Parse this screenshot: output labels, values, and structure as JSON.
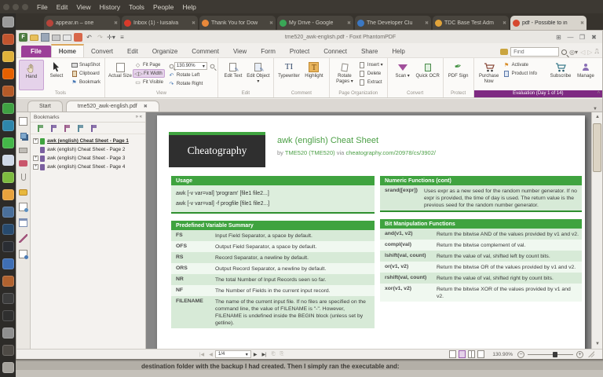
{
  "desktop": {
    "menubar": {
      "items": [
        "File",
        "Edit",
        "View",
        "History",
        "Tools",
        "People",
        "Help"
      ]
    },
    "launcher_items": [
      {
        "name": "settings",
        "color": "#9a9a9a"
      },
      {
        "name": "files",
        "color": "#c0542e"
      },
      {
        "name": "chrome",
        "color": "#e0b23a"
      },
      {
        "name": "firefox",
        "color": "#e66000"
      },
      {
        "name": "terminal",
        "color": "#b35a28"
      },
      {
        "name": "web-green",
        "color": "#3fa142"
      },
      {
        "name": "media-blue",
        "color": "#2e86ab"
      },
      {
        "name": "green-app",
        "color": "#44b749"
      },
      {
        "name": "writer-doc",
        "color": "#cfd8e6"
      },
      {
        "name": "calc-doc",
        "color": "#7dbb3f"
      },
      {
        "name": "impress-doc",
        "color": "#e8a33d"
      },
      {
        "name": "app-mask",
        "color": "#4a6f9a"
      },
      {
        "name": "app-darkblue",
        "color": "#274a6d"
      },
      {
        "name": "steam",
        "color": "#2a2d33"
      },
      {
        "name": "browser-blue",
        "color": "#3f6fb5"
      },
      {
        "name": "app-orange",
        "color": "#b0622f"
      },
      {
        "name": "camera-dark",
        "color": "#3c3c3c"
      },
      {
        "name": "app-dark",
        "color": "#2f2f2f"
      },
      {
        "name": "screenshot-1",
        "color": "#8f8f8f"
      },
      {
        "name": "image-dark",
        "color": "#4e4a45"
      },
      {
        "name": "screenshot-2",
        "color": "#a5a29c"
      }
    ],
    "page_behind_text": "destination folder with the backup I had created. Then I simply ran the executable and:"
  },
  "browser": {
    "tabs": [
      {
        "label": "appear.in – one",
        "color": "#b8443a",
        "active": false
      },
      {
        "label": "Inbox (1) - luisalva",
        "color": "#d93a2b",
        "active": false
      },
      {
        "label": "Thank You for Dow",
        "color": "#e8883a",
        "active": false
      },
      {
        "label": "My Drive - Google",
        "color": "#3aa757",
        "active": false
      },
      {
        "label": "The Developer Clu",
        "color": "#3b78c3",
        "active": false
      },
      {
        "label": "TDC Base Test Adm",
        "color": "#e0a33a",
        "active": false
      },
      {
        "label": "pdf - Possible to in",
        "color": "#d6482f",
        "active": true
      }
    ]
  },
  "app": {
    "title": "tme520_awk-english.pdf - Foxit PhantomPDF",
    "ribbon_tabs": [
      {
        "label": "File",
        "type": "file"
      },
      {
        "label": "Home",
        "type": "active"
      },
      {
        "label": "Convert",
        "type": "normal"
      },
      {
        "label": "Edit",
        "type": "normal"
      },
      {
        "label": "Organize",
        "type": "normal"
      },
      {
        "label": "Comment",
        "type": "normal"
      },
      {
        "label": "View",
        "type": "normal"
      },
      {
        "label": "Form",
        "type": "normal"
      },
      {
        "label": "Protect",
        "type": "normal"
      },
      {
        "label": "Connect",
        "type": "normal"
      },
      {
        "label": "Share",
        "type": "normal"
      },
      {
        "label": "Help",
        "type": "normal"
      }
    ],
    "find_placeholder": "Find",
    "groups": {
      "tools": {
        "label": "Tools",
        "hand": "Hand",
        "select": "Select",
        "snapshot": "SnapShot",
        "clipboard": "Clipboard",
        "bookmark": "Bookmark"
      },
      "view": {
        "label": "View",
        "actual_size": "Actual Size",
        "fit_page": "Fit Page",
        "fit_width": "Fit Width",
        "fit_visible": "Fit Visible",
        "zoom_value": "130.90%",
        "rotate_left": "Rotate Left",
        "rotate_right": "Rotate Right"
      },
      "edit": {
        "label": "Edit",
        "edit_text": "Edit Text",
        "edit_object": "Edit Object"
      },
      "comment": {
        "label": "Comment",
        "typewriter": "Typewriter",
        "highlight": "Highlight"
      },
      "page_org": {
        "label": "Page Organization",
        "rotate_pages": "Rotate Pages",
        "insert": "Insert",
        "delete": "Delete",
        "extract": "Extract"
      },
      "convert": {
        "label": "Convert",
        "scan": "Scan",
        "quick_ocr": "Quick OCR"
      },
      "protect": {
        "label": "Protect",
        "pdf_sign": "PDF Sign"
      },
      "evaluation": {
        "label": "Evaluation (Day 1 of 14)",
        "purchase": "Purchase Now",
        "activate": "Activate",
        "product_info": "Product Info",
        "subscribe": "Subscribe",
        "manage": "Manage"
      }
    },
    "doc_tabs": {
      "start": "Start",
      "document": "tme520_awk-english.pdf"
    },
    "bookmarks": {
      "title": "Bookmarks",
      "items": [
        {
          "label": "awk (english) Cheat Sheet - Page 1",
          "expand": true,
          "selected": true,
          "icon_color": "#3fa33f"
        },
        {
          "label": "awk (english) Cheat Sheet - Page 2",
          "expand": false,
          "selected": false,
          "icon_color": "#7a5fa0"
        },
        {
          "label": "awk (english) Cheat Sheet - Page 3",
          "expand": true,
          "selected": false,
          "icon_color": "#7a5fa0"
        },
        {
          "label": "awk (english) Cheat Sheet - Page 4",
          "expand": true,
          "selected": false,
          "icon_color": "#7a5fa0"
        }
      ]
    },
    "statusbar": {
      "page": "1/4",
      "zoom": "130.90%"
    }
  },
  "pdf": {
    "logo": "Cheatography",
    "title": "awk (english) Cheat Sheet",
    "by": "by",
    "author": "TME520 (TME520)",
    "via": "via",
    "link": "cheatography.com/20978/cs/3902/",
    "usage": {
      "title": "Usage",
      "lines": [
        "awk [-v var=val] 'program' [file1 file2...]",
        "awk [-v var=val] -f progfile [file1 file2...]"
      ]
    },
    "predefined": {
      "title": "Predefined Variable Summary",
      "rows": [
        {
          "k": "FS",
          "v": "Input Field Separator, a space by default."
        },
        {
          "k": "OFS",
          "v": "Output Field Separator, a space by default."
        },
        {
          "k": "RS",
          "v": "Record Separator, a newline by default."
        },
        {
          "k": "ORS",
          "v": "Output Record Separator, a newline by default."
        },
        {
          "k": "NR",
          "v": "The total Number of Input Records seen so far."
        },
        {
          "k": "NF",
          "v": "The Number of Fields in the current input record."
        },
        {
          "k": "FILENAME",
          "v": "The name of the current input file. If no files are specified on the command line, the value of FILENAME is \"-\". However, FILENAME is undefined inside the BEGIN block (unless set by getline)."
        }
      ]
    },
    "numeric": {
      "title": "Numeric Functions (cont)",
      "rows": [
        {
          "k": "srand([expr])",
          "v": "Uses expr as a new seed for the random number generator. If no expr is provided, the time of day is used. The return value is the previous seed for the random number generator."
        }
      ]
    },
    "bit": {
      "title": "Bit Manipulation Functions",
      "rows": [
        {
          "k": "and(v1, v2)",
          "v": "Return the bitwise AND of the values provided by v1 and v2."
        },
        {
          "k": "compl(val)",
          "v": "Return the bitwise complement of val."
        },
        {
          "k": "lshift(val, count)",
          "v": "Return the value of val, shifted left by count bits."
        },
        {
          "k": "or(v1, v2)",
          "v": "Return the bitwise OR of the values provided by v1 and v2."
        },
        {
          "k": "rshift(val, count)",
          "v": "Return the value of val, shifted right by count bits."
        },
        {
          "k": "xor(v1, v2)",
          "v": "Return the bitwise XOR of the values provided by v1 and v2."
        }
      ]
    }
  },
  "icons": {
    "undo": "↶",
    "redo": "↷",
    "rotate_left": "↶",
    "rotate_right": "↷",
    "close": "✖",
    "dropdown": "▾",
    "prev": "◀",
    "next": "▶",
    "collapse": "^",
    "bm_arrows": "» «",
    "up": "▲",
    "down": "▼"
  }
}
